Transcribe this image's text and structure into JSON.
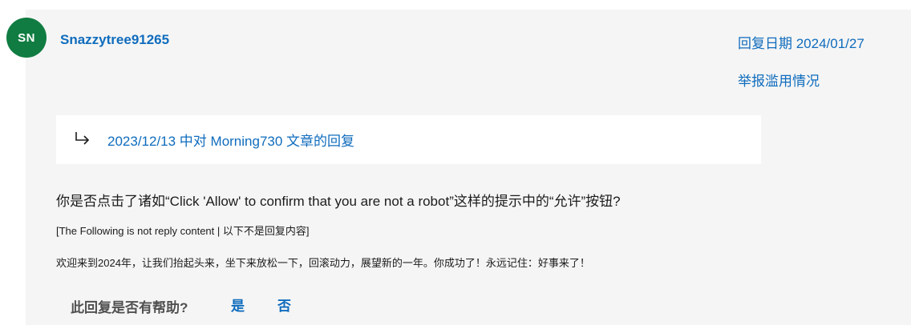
{
  "user": {
    "initials": "SN",
    "name": "Snazzytree91265",
    "avatar_color": "#107c41"
  },
  "meta": {
    "reply_date": "回复日期 2024/01/27",
    "report_abuse": "举报滥用情况"
  },
  "quote": {
    "link_text": "2023/12/13 中对 Morning730 文章的回复"
  },
  "body": {
    "main": "你是否点击了诸如“Click 'Allow' to confirm that you are not a robot”这样的提示中的“允许”按钮?",
    "note": "[The Following is not reply content | 以下不是回复内容]",
    "welcome": "欢迎来到2024年，让我们抬起头来，坐下来放松一下，回滚动力，展望新的一年。你成功了！永远记住：好事来了！"
  },
  "feedback": {
    "question": "此回复是否有帮助?",
    "yes": "是",
    "no": "否"
  },
  "colors": {
    "link": "#0f6cbd",
    "card_bg": "#f5f5f5",
    "text": "#1b1b1b"
  }
}
